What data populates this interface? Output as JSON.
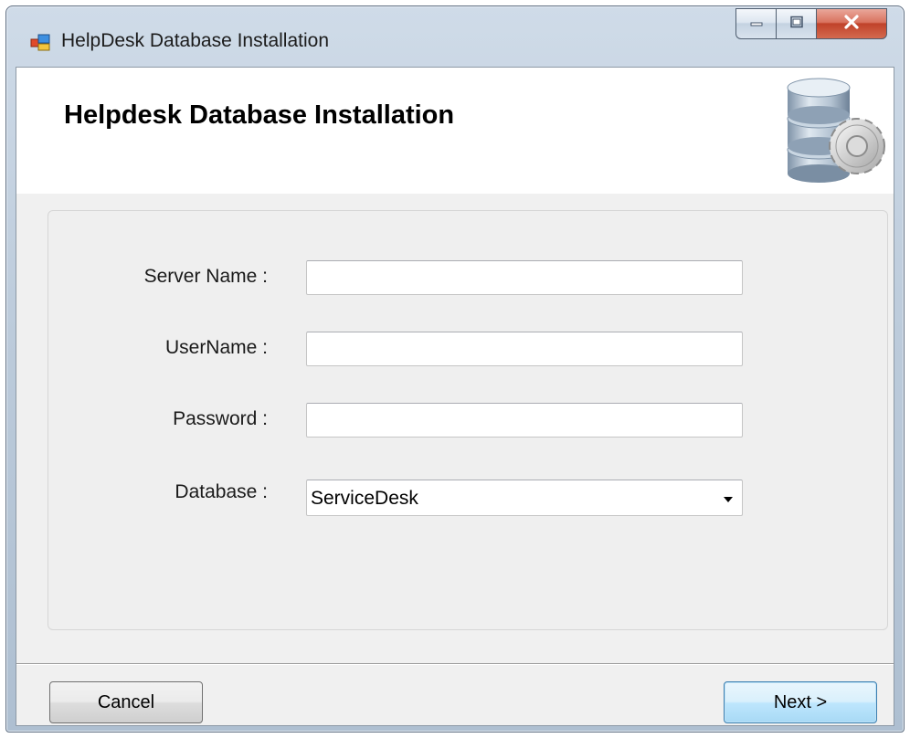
{
  "window": {
    "title": "HelpDesk Database Installation"
  },
  "titlebar_controls": {
    "minimize_icon": "minimize-icon",
    "maximize_icon": "maximize-icon",
    "close_icon": "close-icon",
    "close_color": "#c7462f"
  },
  "header": {
    "title": "Helpdesk Database Installation",
    "icon": "database-gear-icon"
  },
  "form": {
    "server_name_label": "Server Name :",
    "server_name_value": "",
    "username_label": "UserName :",
    "username_value": "",
    "password_label": "Password :",
    "password_value": "",
    "database_label": "Database :",
    "database_selected": "ServiceDesk"
  },
  "buttons": {
    "cancel_label": "Cancel",
    "next_label": "Next >"
  },
  "colors": {
    "header_bg": "#ffffff",
    "form_bg": "#efefef",
    "next_button_accent": "#3c7fb1"
  }
}
